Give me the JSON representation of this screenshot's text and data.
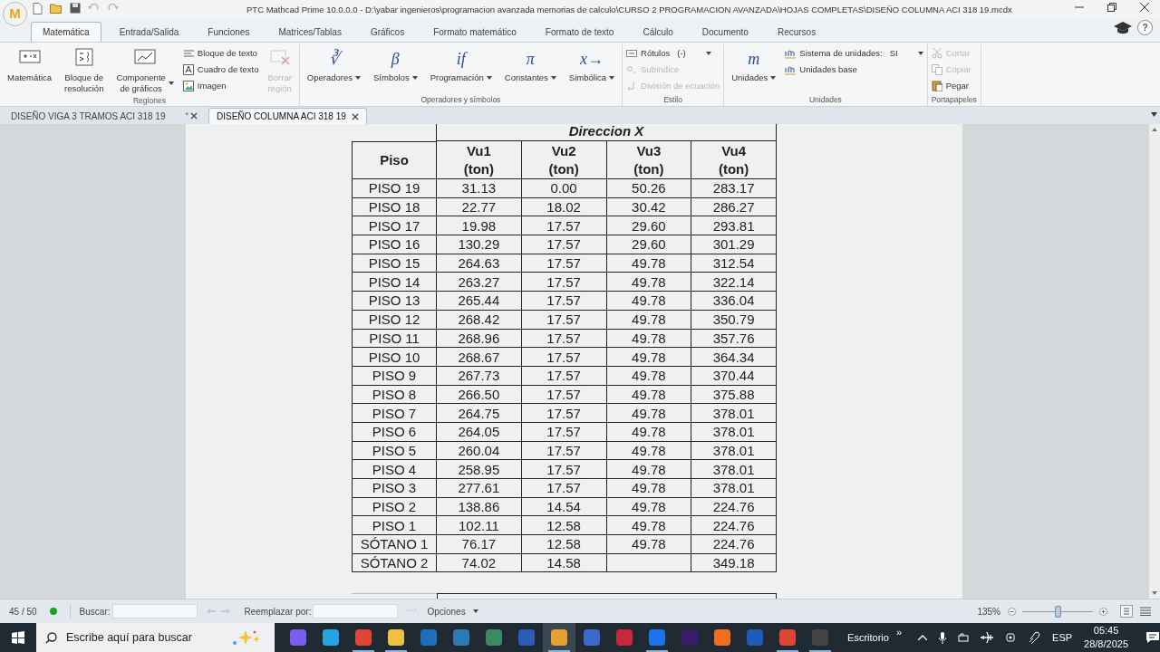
{
  "window": {
    "title": "PTC Mathcad Prime 10.0.0.0 - D:\\yabar ingenieros\\programacion avanzada memorias de calculo\\CURSO 2 PROGRAMACION AVANZADA\\HOJAS COMPLETAS\\DISEÑO COLUMNA ACI 318 19.mcdx",
    "logo": "M"
  },
  "ribbon_tabs": [
    {
      "label": "Matemática",
      "selected": true
    },
    {
      "label": "Entrada/Salida",
      "selected": false
    },
    {
      "label": "Funciones",
      "selected": false
    },
    {
      "label": "Matrices/Tablas",
      "selected": false
    },
    {
      "label": "Gráficos",
      "selected": false
    },
    {
      "label": "Formato matemático",
      "selected": false
    },
    {
      "label": "Formato de texto",
      "selected": false
    },
    {
      "label": "Cálculo",
      "selected": false
    },
    {
      "label": "Documento",
      "selected": false
    },
    {
      "label": "Recursos",
      "selected": false
    }
  ],
  "help": "?",
  "ribbon_groups": [
    {
      "title": "Regiones",
      "items": [
        {
          "kind": "large",
          "label": "Matemática",
          "dropdown": false,
          "disabled": false
        },
        {
          "kind": "large",
          "label": "Bloque de\nresolución",
          "dropdown": false,
          "disabled": false
        },
        {
          "kind": "large",
          "label": "Componente\nde gráficos",
          "dropdown": true,
          "disabled": false
        },
        {
          "kind": "stack",
          "items": [
            {
              "label": "Bloque de texto",
              "disabled": false
            },
            {
              "label": "Cuadro de texto",
              "disabled": false
            },
            {
              "label": "Imagen",
              "disabled": false
            }
          ]
        },
        {
          "kind": "large",
          "label": "Borrar\nregión",
          "dropdown": false,
          "disabled": true
        }
      ]
    },
    {
      "title": "Operadores y símbolos",
      "items": [
        {
          "kind": "large",
          "glyph": "∛",
          "label": "Operadores",
          "dropdown": true,
          "disabled": false
        },
        {
          "kind": "large",
          "glyph": "β",
          "label": "Símbolos",
          "dropdown": true,
          "disabled": false
        },
        {
          "kind": "large",
          "glyph": "if",
          "label": "Programación",
          "dropdown": true,
          "disabled": false
        },
        {
          "kind": "large",
          "glyph": "π",
          "label": "Constantes",
          "dropdown": true,
          "disabled": false
        },
        {
          "kind": "large",
          "glyph": "x→",
          "label": "Simbólica",
          "dropdown": true,
          "disabled": false
        }
      ]
    },
    {
      "title": "Estilo",
      "items": [
        {
          "kind": "stack",
          "items": [
            {
              "label": "Rótulos",
              "value": "(-)",
              "dropdown": true,
              "disabled": false
            },
            {
              "label": "Subíndice",
              "disabled": true
            },
            {
              "label": "División de ecuación",
              "disabled": true
            }
          ]
        }
      ]
    },
    {
      "title": "Unidades",
      "items": [
        {
          "kind": "large",
          "glyph": "m",
          "label": "Unidades",
          "dropdown": true,
          "disabled": false
        },
        {
          "kind": "stack",
          "items": [
            {
              "label": "Sistema de unidades:",
              "value": "SI",
              "dropdown": true,
              "disabled": false
            },
            {
              "label": "Unidades base",
              "disabled": false
            }
          ]
        }
      ]
    },
    {
      "title": "Portapapeles",
      "items": [
        {
          "kind": "stack",
          "items": [
            {
              "label": "Cortar",
              "disabled": true
            },
            {
              "label": "Copiar",
              "disabled": true
            },
            {
              "label": "Pegar",
              "disabled": false
            }
          ]
        }
      ]
    }
  ],
  "document_tabs": [
    {
      "label": "DISEÑO VIGA 3 TRAMOS ACI 318 19",
      "modified": "*",
      "selected": false
    },
    {
      "label": "DISEÑO COLUMNA ACI 318 19",
      "selected": true
    }
  ],
  "table": {
    "group_header": "Direccion X",
    "columns": [
      {
        "name": "Piso"
      },
      {
        "name": "Vu1",
        "unit": "(ton)"
      },
      {
        "name": "Vu2",
        "unit": "(ton)"
      },
      {
        "name": "Vu3",
        "unit": "(ton)"
      },
      {
        "name": "Vu4",
        "unit": "(ton)"
      }
    ],
    "rows": [
      [
        "PISO 19",
        "31.13",
        "0.00",
        "50.26",
        "283.17"
      ],
      [
        "PISO 18",
        "22.77",
        "18.02",
        "30.42",
        "286.27"
      ],
      [
        "PISO 17",
        "19.98",
        "17.57",
        "29.60",
        "293.81"
      ],
      [
        "PISO 16",
        "130.29",
        "17.57",
        "29.60",
        "301.29"
      ],
      [
        "PISO 15",
        "264.63",
        "17.57",
        "49.78",
        "312.54"
      ],
      [
        "PISO 14",
        "263.27",
        "17.57",
        "49.78",
        "322.14"
      ],
      [
        "PISO 13",
        "265.44",
        "17.57",
        "49.78",
        "336.04"
      ],
      [
        "PISO 12",
        "268.42",
        "17.57",
        "49.78",
        "350.79"
      ],
      [
        "PISO 11",
        "268.96",
        "17.57",
        "49.78",
        "357.76"
      ],
      [
        "PISO 10",
        "268.67",
        "17.57",
        "49.78",
        "364.34"
      ],
      [
        "PISO 9",
        "267.73",
        "17.57",
        "49.78",
        "370.44"
      ],
      [
        "PISO 8",
        "266.50",
        "17.57",
        "49.78",
        "375.88"
      ],
      [
        "PISO 7",
        "264.75",
        "17.57",
        "49.78",
        "378.01"
      ],
      [
        "PISO 6",
        "264.05",
        "17.57",
        "49.78",
        "378.01"
      ],
      [
        "PISO 5",
        "260.04",
        "17.57",
        "49.78",
        "378.01"
      ],
      [
        "PISO 4",
        "258.95",
        "17.57",
        "49.78",
        "378.01"
      ],
      [
        "PISO 3",
        "277.61",
        "17.57",
        "49.78",
        "378.01"
      ],
      [
        "PISO 2",
        "138.86",
        "14.54",
        "49.78",
        "224.76"
      ],
      [
        "PISO 1",
        "102.11",
        "12.58",
        "49.78",
        "224.76"
      ],
      [
        "SÓTANO 1",
        "76.17",
        "12.58",
        "49.78",
        "224.76"
      ],
      [
        "SÓTANO 2",
        "74.02",
        "14.58",
        "",
        "349.18"
      ]
    ]
  },
  "status_bar": {
    "page": "45 / 50",
    "search_label": "Buscar:",
    "replace_label": "Reemplazar por:",
    "options": "Opciones",
    "zoom": "135%",
    "zoom_slider": {
      "level": 0.5
    }
  },
  "taskbar": {
    "search_placeholder": "Escribe aquí para buscar",
    "apps": [
      {
        "color": "#7b5cf0",
        "open": false,
        "selected": false
      },
      {
        "color": "#2aa3e0",
        "open": false,
        "selected": false
      },
      {
        "color": "#e04434",
        "open": true,
        "selected": false
      },
      {
        "color": "#f0c040",
        "open": true,
        "selected": false
      },
      {
        "color": "#1e6fb8",
        "open": false,
        "selected": false
      },
      {
        "color": "#2a7ab8",
        "open": false,
        "selected": false
      },
      {
        "color": "#3a8a6a",
        "open": false,
        "selected": false
      },
      {
        "color": "#2b5cb8",
        "open": false,
        "selected": false
      },
      {
        "color": "#e8a030",
        "open": true,
        "selected": true
      },
      {
        "color": "#3a6ac8",
        "open": false,
        "selected": false
      },
      {
        "color": "#c8283a",
        "open": false,
        "selected": false
      },
      {
        "color": "#1a73e8",
        "open": true,
        "selected": false
      },
      {
        "color": "#3a1a6a",
        "open": false,
        "selected": false
      },
      {
        "color": "#f07020",
        "open": false,
        "selected": false
      },
      {
        "color": "#1e5ab8",
        "open": false,
        "selected": false
      },
      {
        "color": "#e04434",
        "open": true,
        "selected": false
      },
      {
        "color": "#444444",
        "open": true,
        "selected": false
      }
    ],
    "desktop": "Escritorio",
    "more": "»",
    "language": "ESP",
    "time": "05:45",
    "date": "28/8/2025"
  }
}
